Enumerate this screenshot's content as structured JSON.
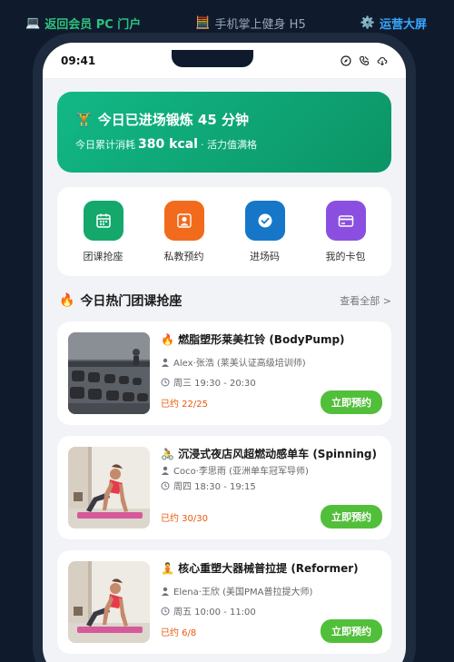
{
  "topnav": {
    "back_icon": "laptop-icon",
    "back_label": "返回会员 PC 门户",
    "h5_icon": "abacus-icon",
    "h5_label": "手机掌上健身 H5",
    "screen_icon": "gear-icon",
    "screen_label": "运营大屏"
  },
  "status": {
    "time": "09:41",
    "icons": [
      "compass-icon",
      "phone-icon",
      "cloud-icon"
    ]
  },
  "hero": {
    "icon": "dumbbell-icon",
    "title": "今日已进场锻炼 45 分钟",
    "sub_prefix": "今日累计消耗",
    "kcal": "380 kcal",
    "sub_suffix": "· 活力值满格",
    "color": "#12b886"
  },
  "quick": [
    {
      "label": "团课抢座",
      "icon": "calendar-icon",
      "color": "#14a86c"
    },
    {
      "label": "私教预约",
      "icon": "person-icon",
      "color": "#f26b1d"
    },
    {
      "label": "进场码",
      "icon": "check-circle-icon",
      "color": "#1677c9"
    },
    {
      "label": "我的卡包",
      "icon": "card-icon",
      "color": "#8a4fe0"
    }
  ],
  "section": {
    "title": "今日热门团课抢座",
    "more": "查看全部 >"
  },
  "courses": [
    {
      "emoji": "🔥",
      "title": "燃脂塑形莱美杠铃 (BodyPump)",
      "coach": "Alex·张浩 (莱美认证高级培训师)",
      "time": "周三 19:30 - 20:30",
      "booked": "已约 22/25",
      "button": "立即预约",
      "image": "dumbbell-rack-photo"
    },
    {
      "emoji": "🚴",
      "title": "沉浸式夜店风超燃动感单车 (Spinning)",
      "coach": "Coco·李思雨 (亚洲单车冠军导师)",
      "time": "周四 18:30 - 19:15",
      "booked": "已约 30/30",
      "button": "立即预约",
      "image": "yoga-plank-photo"
    },
    {
      "emoji": "🧘",
      "title": "核心重塑大器械普拉提 (Reformer)",
      "coach": "Elena·王欣 (美国PMA普拉提大师)",
      "time": "周五 10:00 - 11:00",
      "booked": "已约 6/8",
      "button": "立即预约",
      "image": "yoga-plank-photo"
    }
  ]
}
